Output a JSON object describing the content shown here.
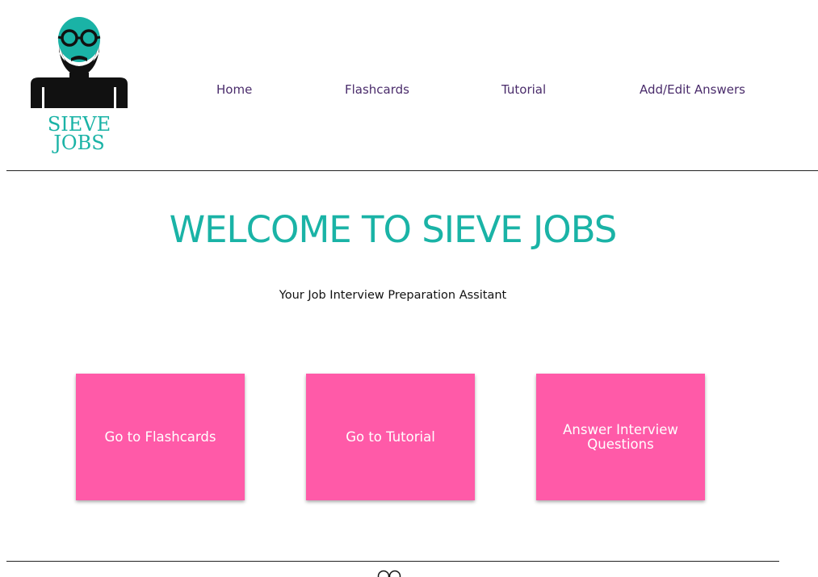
{
  "brand": {
    "line1": "SIEVE",
    "line2": "JOBS",
    "logo_icon": "bald-bearded-man-with-glasses-icon",
    "accent_color": "#1ab3a6"
  },
  "nav": {
    "items": [
      {
        "label": "Home"
      },
      {
        "label": "Flashcards"
      },
      {
        "label": "Tutorial"
      },
      {
        "label": "Add/Edit Answers"
      }
    ],
    "text_color": "#4a2c6b"
  },
  "main": {
    "title": "WELCOME TO SIEVE JOBS",
    "subtitle": "Your Job Interview Preparation Assitant"
  },
  "cards": [
    {
      "label": "Go to Flashcards"
    },
    {
      "label": "Go to Tutorial"
    },
    {
      "label": "Answer Interview Questions"
    }
  ],
  "card_color": "#ff5aa8",
  "footer": {
    "icon": "glasses-icon"
  }
}
